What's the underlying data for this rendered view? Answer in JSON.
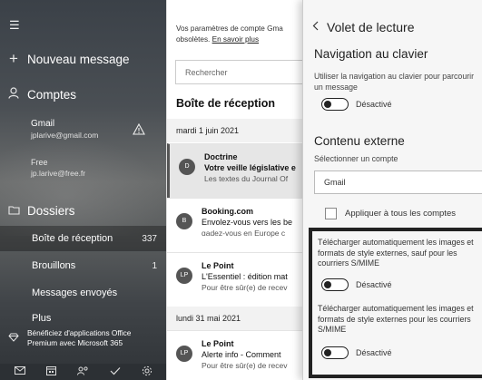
{
  "sidebar": {
    "new_message": "Nouveau message",
    "accounts_title": "Comptes",
    "accounts": [
      {
        "name": "Gmail",
        "email": "jplarive@gmail.com",
        "warning": true
      },
      {
        "name": "Free",
        "email": "jp.larive@free.fr"
      }
    ],
    "folders_title": "Dossiers",
    "folders": [
      {
        "label": "Boîte de réception",
        "count": "337"
      },
      {
        "label": "Brouillons",
        "count": "1"
      },
      {
        "label": "Messages envoyés",
        "count": ""
      },
      {
        "label": "Plus",
        "count": ""
      }
    ],
    "promo": "Bénéficiez d'applications Office Premium avec Microsoft 365",
    "footer_icons": [
      "mail-icon",
      "calendar-icon",
      "people-icon",
      "todo-icon",
      "settings-icon"
    ]
  },
  "mail_list": {
    "notice_text": "Vos paramètres de compte Gma",
    "notice_text2": "obsolètes.",
    "notice_link": "En savoir plus",
    "search_placeholder": "Rechercher",
    "inbox_title": "Boîte de réception",
    "groups": [
      {
        "date": "mardi 1 juin 2021",
        "items": [
          {
            "initials": "D",
            "sender": "Doctrine",
            "subject": "Votre veille législative e",
            "preview": "Les textes du Journal Of",
            "selected": true
          },
          {
            "initials": "B",
            "sender": "Booking.com",
            "subject": "Envolez-vous vers les be",
            "preview": "ɑadez-vous en Europe c",
            "selected": false
          },
          {
            "initials": "LP",
            "sender": "Le Point",
            "subject": "L'Essentiel : édition mat",
            "preview": "Pour être sûr(e) de recev",
            "selected": false
          }
        ]
      },
      {
        "date": "lundi 31 mai 2021",
        "items": [
          {
            "initials": "LP",
            "sender": "Le Point",
            "subject": "Alerte info - Comment",
            "preview": "Pour être sûr(e) de recev",
            "selected": false
          }
        ]
      }
    ]
  },
  "reading_pane": {
    "title": "Volet de lecture",
    "keyboard_nav_title": "Navigation au clavier",
    "keyboard_nav_desc": "Utiliser la navigation au clavier pour parcourir un message",
    "keyboard_nav_state": "Désactivé",
    "external_content_title": "Contenu externe",
    "select_account_label": "Sélectionner un compte",
    "selected_account": "Gmail",
    "apply_all_label": "Appliquer à tous les comptes",
    "auto_download_1": "Télécharger automatiquement les images et formats de style externes, sauf pour les courriers S/MIME",
    "auto_download_1_state": "Désactivé",
    "auto_download_2": "Télécharger automatiquement les images et formats de style externes pour les courriers S/MIME",
    "auto_download_2_state": "Désactivé"
  }
}
